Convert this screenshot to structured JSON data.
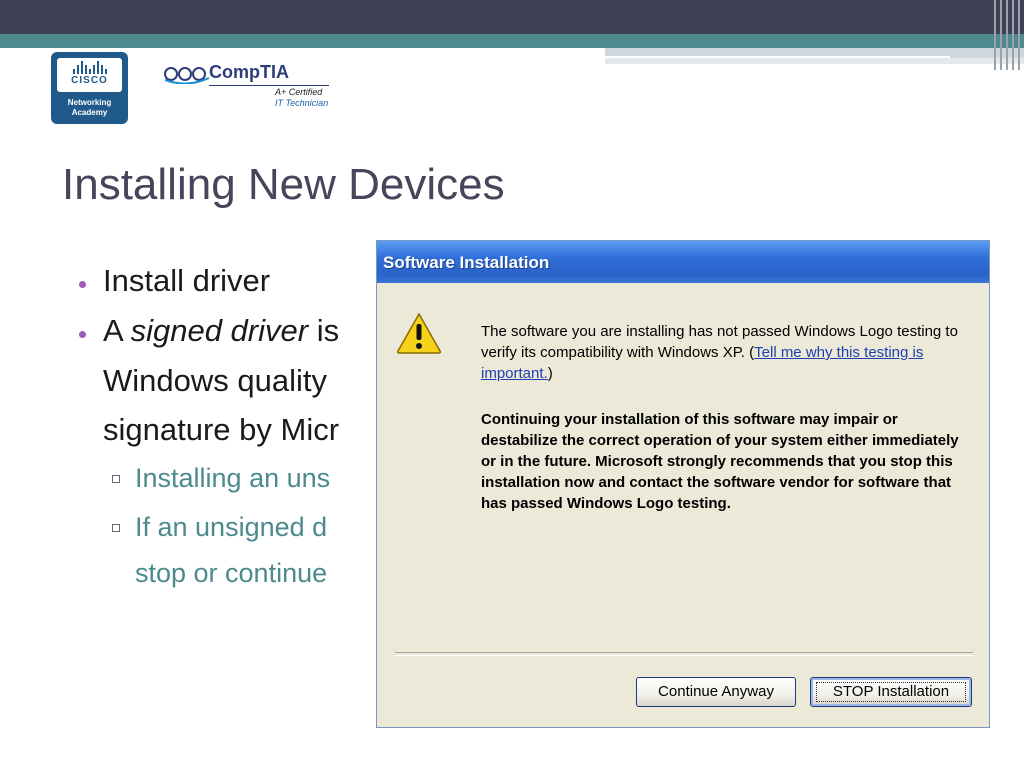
{
  "logos": {
    "cisco_word": "CISCO",
    "cisco_sub": "Networking\nAcademy",
    "comptia_word": "CompTIA",
    "comptia_cert": "A+ Certified",
    "comptia_it": "IT Technician"
  },
  "slide": {
    "title": "Installing New Devices",
    "bullets": [
      "Install driver",
      "A ",
      "signed driver",
      " is",
      "Windows quality",
      "signature by Micr"
    ],
    "sub_bullets": [
      "Installing an uns",
      "If an unsigned d",
      "stop or continue"
    ]
  },
  "dialog": {
    "title": "Software Installation",
    "message_prefix": "The software you are installing has not passed Windows Logo testing to verify its compatibility with Windows XP. (",
    "message_link": "Tell me why this testing is important.",
    "message_suffix": ")",
    "warning": "Continuing your installation of this software may impair or destabilize the correct operation of your system either immediately or in the future. Microsoft strongly recommends that you stop this installation now and contact the software vendor for software that has passed Windows Logo testing.",
    "buttons": {
      "continue": "Continue Anyway",
      "stop": "STOP Installation"
    }
  },
  "colors": {
    "title_text": "#45465a",
    "accent_teal": "#4d8a8d",
    "bullet_purple": "#9c5bb5",
    "xp_title_blue": "#2a62c9"
  },
  "icons": [
    "warning-icon"
  ]
}
